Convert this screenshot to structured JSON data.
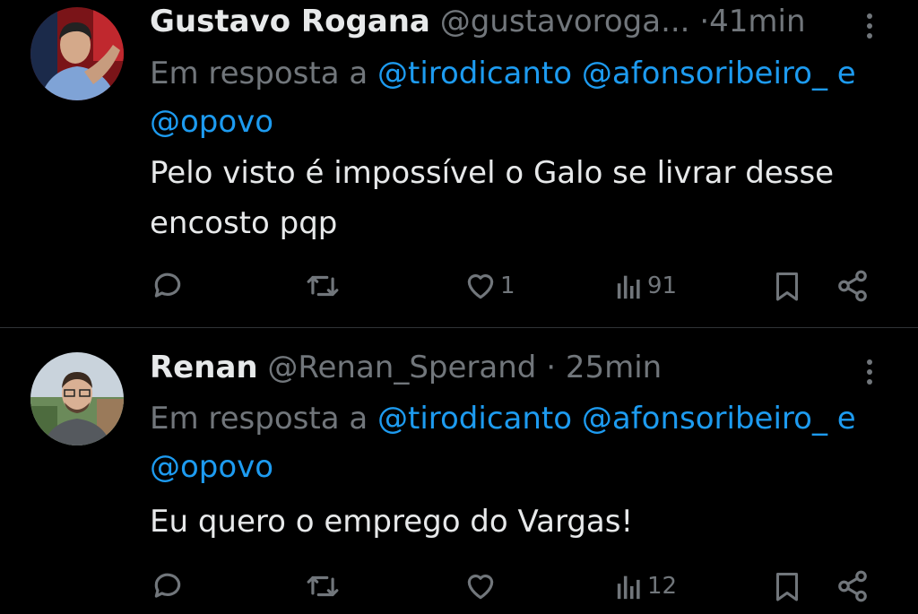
{
  "tweets": [
    {
      "display_name": "Gustavo Rogana",
      "handle": "@gustavoroga...",
      "separator": "·",
      "time": "41min",
      "reply_prefix": "Em resposta a",
      "mentions": [
        "@tirodicanto",
        "@afonsoribeiro_",
        "@opovo"
      ],
      "mention_joiner": "e",
      "text": "Pelo visto é impossível o Galo se livrar desse encosto pqp",
      "likes": "1",
      "views": "91",
      "avatar_icon": "profile-photo"
    },
    {
      "display_name": "Renan",
      "handle": "@Renan_Sperand",
      "separator": "·",
      "time": "25min",
      "reply_prefix": "Em resposta a",
      "mentions": [
        "@tirodicanto",
        "@afonsoribeiro_",
        "@opovo"
      ],
      "mention_joiner": "e",
      "text": "Eu quero o emprego do Vargas!",
      "likes": "",
      "views": "12",
      "avatar_icon": "profile-photo"
    }
  ],
  "icons": {
    "reply": "speech-bubble-icon",
    "retweet": "retweet-arrows-icon",
    "like": "heart-icon",
    "views": "bar-chart-icon",
    "bookmark": "bookmark-icon",
    "share": "share-icon",
    "more": "vertical-dots-icon"
  },
  "colors": {
    "background": "#000000",
    "text": "#e7e9ea",
    "muted": "#71767b",
    "link": "#1d9bf0",
    "divider": "#2f3336"
  }
}
